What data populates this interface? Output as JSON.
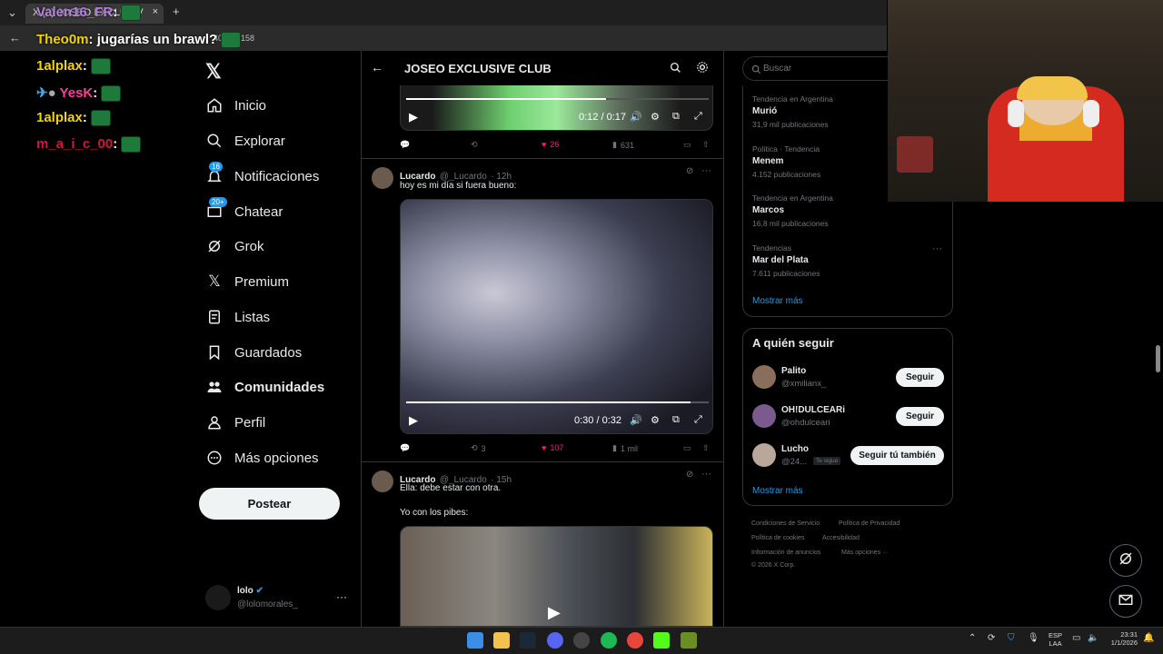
{
  "browser": {
    "tab_title": "X  (2) JOSEO EXCLUSIV",
    "tab_close": "×",
    "new_tab": "+",
    "url_tail": "407805158"
  },
  "chat": [
    {
      "user": "Valen16_FR",
      "color": "#b57edc",
      "msg": ""
    },
    {
      "user": "Theo0m",
      "color": "#f2d400",
      "msg": "jugarías un brawl?"
    },
    {
      "user": "1alplax",
      "color": "#f2d400",
      "msg": ""
    },
    {
      "user": "YesK",
      "color": "#ff3b9a",
      "msg": ""
    },
    {
      "user": "1alplax",
      "color": "#f2d400",
      "msg": ""
    },
    {
      "user": "m_a_i_c_00",
      "color": "#d4143c",
      "msg": ""
    }
  ],
  "nav": {
    "items": [
      {
        "label": "Inicio",
        "icon": "home-icon",
        "badge": ""
      },
      {
        "label": "Explorar",
        "icon": "search-icon",
        "badge": ""
      },
      {
        "label": "Notificaciones",
        "icon": "bell-icon",
        "badge": "16"
      },
      {
        "label": "Chatear",
        "icon": "mail-icon",
        "badge": "20+"
      },
      {
        "label": "Grok",
        "icon": "grok-icon",
        "badge": ""
      },
      {
        "label": "Premium",
        "icon": "x-logo-icon",
        "badge": ""
      },
      {
        "label": "Listas",
        "icon": "list-icon",
        "badge": ""
      },
      {
        "label": "Guardados",
        "icon": "bookmark-icon",
        "badge": ""
      },
      {
        "label": "Comunidades",
        "icon": "people-icon",
        "badge": ""
      },
      {
        "label": "Perfil",
        "icon": "person-icon",
        "badge": ""
      },
      {
        "label": "Más opciones",
        "icon": "more-circle-icon",
        "badge": ""
      }
    ],
    "post_label": "Postear",
    "account_name": "lolo",
    "account_handle": "@lolomorales_"
  },
  "community": {
    "title": "JOSEO EXCLUSIVE CLUB"
  },
  "video1": {
    "time": "0:12 / 0:17",
    "progress": 0.66
  },
  "tweet1_actions": {
    "retweets": "",
    "likes": "26",
    "views": "631"
  },
  "tweet2": {
    "name": "Lucardo",
    "handle": "@_Lucardo",
    "time": "· 12h",
    "text": "hoy es mi día si fuera bueno:",
    "video_time": "0:30 / 0:32",
    "progress": 0.94,
    "retweets": "3",
    "likes": "107",
    "views": "1 mil"
  },
  "tweet3": {
    "name": "Lucardo",
    "handle": "@_Lucardo",
    "time": "· 15h",
    "text1": "Ella: debe estar con otra.",
    "text2": "Yo con los pibes:"
  },
  "search": {
    "placeholder": "Buscar"
  },
  "trends": [
    {
      "category": "Tendencia en Argentina",
      "name": "Murió",
      "count": "31,9 mil publicaciones"
    },
    {
      "category": "Política · Tendencia",
      "name": "Menem",
      "count": "4.152 publicaciones"
    },
    {
      "category": "Tendencia en Argentina",
      "name": "Marcos",
      "count": "16,8 mil publicaciones"
    },
    {
      "category": "Tendencias",
      "name": "Mar del Plata",
      "count": "7.611 publicaciones"
    }
  ],
  "show_more": "Mostrar más",
  "who_to_follow": {
    "title": "A quién seguir",
    "users": [
      {
        "name": "Palito",
        "handle": "@xmilianx_",
        "button": "Seguir",
        "follows_you": ""
      },
      {
        "name": "OH!DULCEARi",
        "handle": "@ohdulceari",
        "button": "Seguir",
        "follows_you": ""
      },
      {
        "name": "Lucho",
        "handle": "@24...",
        "button": "Seguir tú también",
        "follows_you": "Te sigue"
      }
    ],
    "show_more": "Mostrar más"
  },
  "footer": {
    "l1a": "Condiciones de Servicio",
    "l1b": "Política de Privacidad",
    "l2a": "Política de cookies",
    "l2b": "Accesibilidad",
    "l3a": "Información de anuncios",
    "l3b": "Más opciones ···",
    "copy": "© 2026 X Corp."
  },
  "taskbar": {
    "lang1": "ESP",
    "lang2": "LAA",
    "time": "23:31",
    "date": "1/1/2026"
  }
}
